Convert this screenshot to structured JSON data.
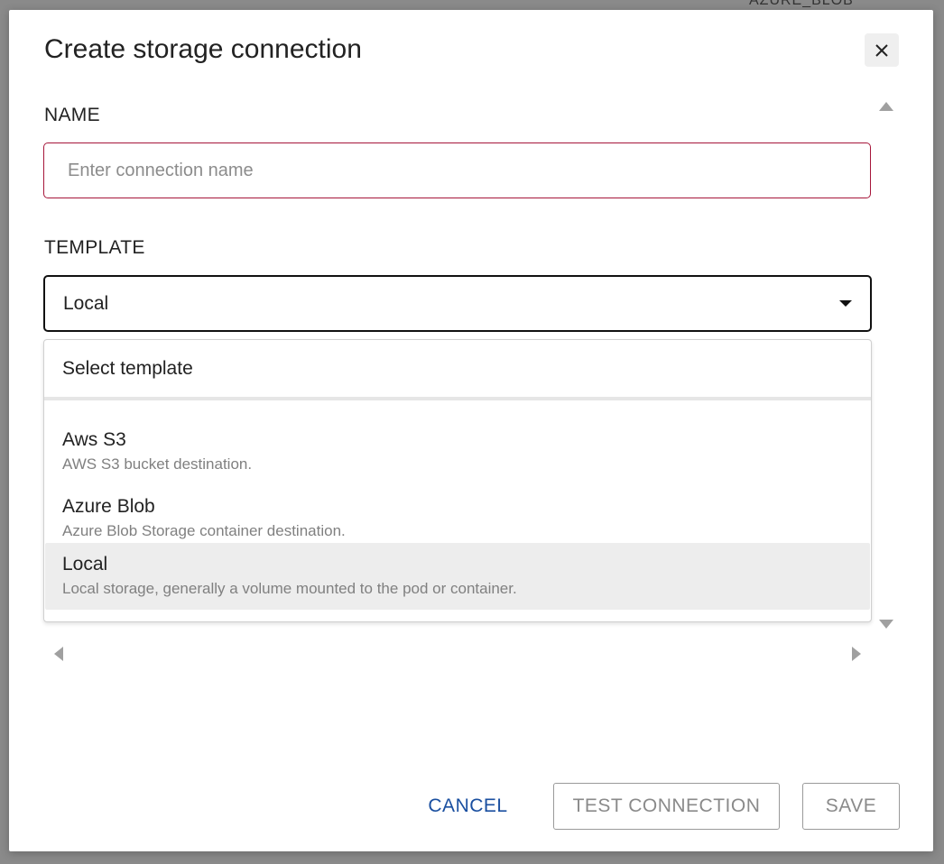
{
  "background": {
    "partial_text": "AZURE_BLOB"
  },
  "modal": {
    "title": "Create storage connection",
    "close_icon": "close-icon"
  },
  "name_field": {
    "label": "NAME",
    "value": "",
    "placeholder": "Enter connection name",
    "error_border_color": "#a6163a"
  },
  "template_field": {
    "label": "TEMPLATE",
    "selected_value": "Local",
    "dropdown_icon": "caret-down-icon"
  },
  "dropdown": {
    "header": "Select template",
    "options": [
      {
        "title": "Aws S3",
        "description": "AWS S3 bucket destination.",
        "selected": false
      },
      {
        "title": "Azure Blob",
        "description": "Azure Blob Storage container destination.",
        "selected": false
      },
      {
        "title": "Local",
        "description": "Local storage, generally a volume mounted to the pod or container.",
        "selected": true
      }
    ]
  },
  "scroll_arrows": [
    "scroll-up-icon",
    "scroll-down-icon",
    "scroll-left-icon",
    "scroll-right-icon"
  ],
  "footer": {
    "cancel_label": "CANCEL",
    "test_label": "TEST CONNECTION",
    "save_label": "SAVE"
  },
  "colors": {
    "accent_blue": "#1a4fa0",
    "selected_option_bg": "#ededed",
    "disabled_text": "#8a8a8a"
  }
}
